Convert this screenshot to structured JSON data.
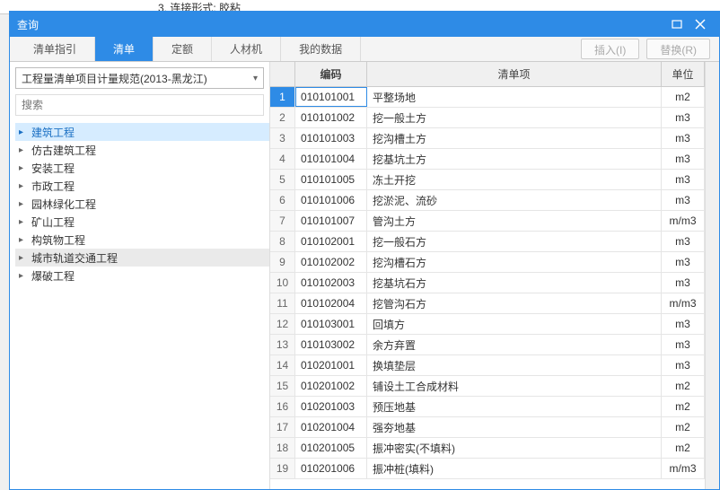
{
  "bg_note": "3. 连接形式: 胶粘",
  "title": "查询",
  "tabs": [
    "清单指引",
    "清单",
    "定额",
    "人材机",
    "我的数据"
  ],
  "active_tab_index": 1,
  "buttons": {
    "insert": "插入(I)",
    "replace": "替换(R)"
  },
  "dropdown_value": "工程量清单项目计量规范(2013-黑龙江)",
  "search_placeholder": "搜索",
  "tree": [
    {
      "label": "建筑工程",
      "selected": true
    },
    {
      "label": "仿古建筑工程"
    },
    {
      "label": "安装工程"
    },
    {
      "label": "市政工程"
    },
    {
      "label": "园林绿化工程"
    },
    {
      "label": "矿山工程"
    },
    {
      "label": "构筑物工程"
    },
    {
      "label": "城市轨道交通工程",
      "hover": true
    },
    {
      "label": "爆破工程"
    }
  ],
  "columns": {
    "code": "编码",
    "item": "清单项",
    "unit": "单位"
  },
  "rows": [
    {
      "n": 1,
      "code": "010101001",
      "item": "平整场地",
      "unit": "m2",
      "sel": true
    },
    {
      "n": 2,
      "code": "010101002",
      "item": "挖一般土方",
      "unit": "m3"
    },
    {
      "n": 3,
      "code": "010101003",
      "item": "挖沟槽土方",
      "unit": "m3"
    },
    {
      "n": 4,
      "code": "010101004",
      "item": "挖基坑土方",
      "unit": "m3"
    },
    {
      "n": 5,
      "code": "010101005",
      "item": "冻土开挖",
      "unit": "m3"
    },
    {
      "n": 6,
      "code": "010101006",
      "item": "挖淤泥、流砂",
      "unit": "m3"
    },
    {
      "n": 7,
      "code": "010101007",
      "item": "管沟土方",
      "unit": "m/m3"
    },
    {
      "n": 8,
      "code": "010102001",
      "item": "挖一般石方",
      "unit": "m3"
    },
    {
      "n": 9,
      "code": "010102002",
      "item": "挖沟槽石方",
      "unit": "m3"
    },
    {
      "n": 10,
      "code": "010102003",
      "item": "挖基坑石方",
      "unit": "m3"
    },
    {
      "n": 11,
      "code": "010102004",
      "item": "挖管沟石方",
      "unit": "m/m3"
    },
    {
      "n": 12,
      "code": "010103001",
      "item": "回填方",
      "unit": "m3"
    },
    {
      "n": 13,
      "code": "010103002",
      "item": "余方弃置",
      "unit": "m3"
    },
    {
      "n": 14,
      "code": "010201001",
      "item": "换填垫层",
      "unit": "m3"
    },
    {
      "n": 15,
      "code": "010201002",
      "item": "铺设土工合成材料",
      "unit": "m2"
    },
    {
      "n": 16,
      "code": "010201003",
      "item": "预压地基",
      "unit": "m2"
    },
    {
      "n": 17,
      "code": "010201004",
      "item": "强夯地基",
      "unit": "m2"
    },
    {
      "n": 18,
      "code": "010201005",
      "item": "振冲密实(不填料)",
      "unit": "m2"
    },
    {
      "n": 19,
      "code": "010201006",
      "item": "振冲桩(填料)",
      "unit": "m/m3"
    }
  ]
}
